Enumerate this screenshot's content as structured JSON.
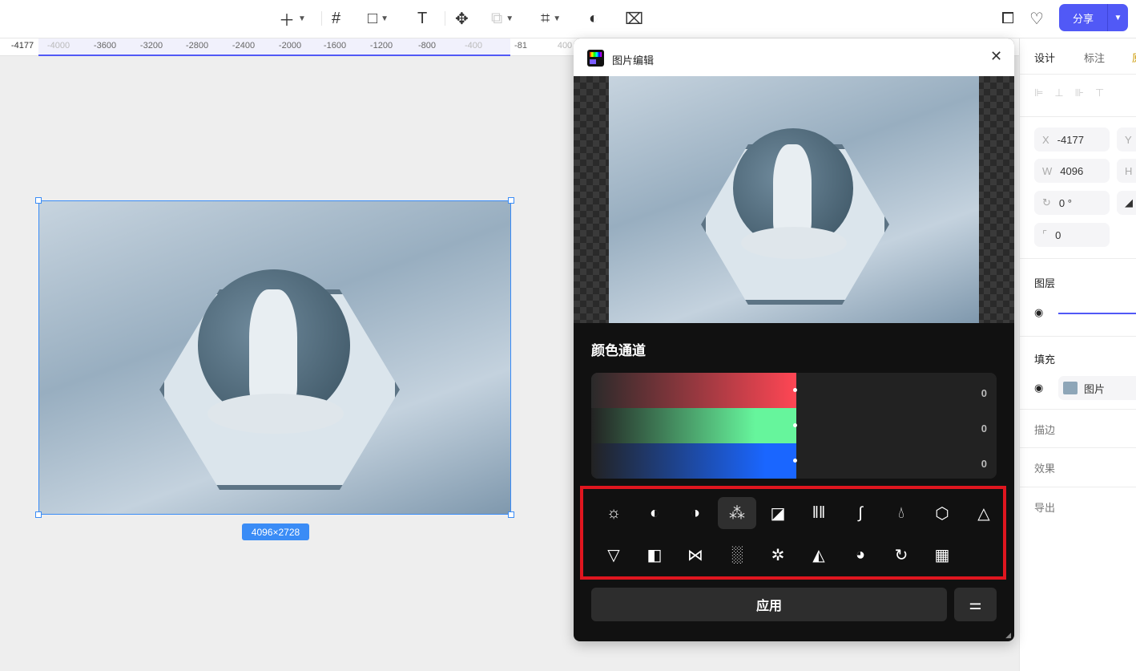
{
  "toolbar": {
    "tools": [
      "add",
      "frame",
      "rectangle",
      "text",
      "component",
      "boolean",
      "vector",
      "mask",
      "crop"
    ],
    "share_label": "分享"
  },
  "ruler": {
    "ticks": [
      "-4177",
      "-4000",
      "-3600",
      "-3200",
      "-2800",
      "-2400",
      "-2000",
      "-1600",
      "-1200",
      "-800",
      "-400",
      "-81",
      "400"
    ]
  },
  "canvas": {
    "size_label": "4096×2728"
  },
  "dialog": {
    "title": "图片编辑",
    "section_title": "颜色通道",
    "channels": [
      {
        "name": "red",
        "value": "0",
        "color": "#ff4654"
      },
      {
        "name": "green",
        "value": "0",
        "color": "#66f59c"
      },
      {
        "name": "blue",
        "value": "0",
        "color": "#1a66ff"
      }
    ],
    "channel_fill": 0.5,
    "tools": [
      "brightness",
      "contrast",
      "grayscale-contrast",
      "color-channels",
      "exposure",
      "lines",
      "curves",
      "saturation",
      "hue",
      "sharpen",
      "vignette",
      "invert",
      "symmetry",
      "noise",
      "blur",
      "fill",
      "lens",
      "swirl",
      "mosaic"
    ],
    "selected_tool": "color-channels",
    "apply_label": "应用"
  },
  "right_panel": {
    "tabs": [
      "设计",
      "标注",
      "原"
    ],
    "x_label": "X",
    "x_value": "-4177",
    "y_label": "Y",
    "w_label": "W",
    "w_value": "4096",
    "h_label": "H",
    "rotation_value": "0 °",
    "radius_value": "0",
    "layer_title": "图层",
    "fill_title": "填充",
    "fill_type": "图片",
    "stroke_title": "描边",
    "effect_title": "效果",
    "export_title": "导出"
  }
}
